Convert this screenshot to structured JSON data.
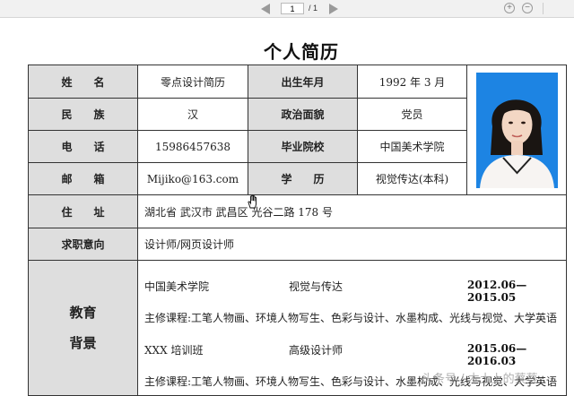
{
  "toolbar": {
    "page_current": "1",
    "page_total": "/ 1",
    "zoom_in": "+",
    "zoom_out": "−"
  },
  "resume": {
    "title": "个人简历",
    "rows": {
      "name_label": "姓　　名",
      "name_value": "零点设计简历",
      "birth_label": "出生年月",
      "birth_value": "1992 年 3 月",
      "ethnic_label": "民　　族",
      "ethnic_value": "汉",
      "political_label": "政治面貌",
      "political_value": "党员",
      "phone_label": "电　　话",
      "phone_value": "15986457638",
      "school_label": "毕业院校",
      "school_value": "中国美术学院",
      "email_label": "邮　　箱",
      "email_value": "Mijiko@163.com",
      "degree_label": "学　　历",
      "degree_value": "视觉传达(本科)",
      "address_label": "住　　址",
      "address_value": "湖北省  武汉市  武昌区  光谷二路  178 号",
      "intent_label": "求职意向",
      "intent_value": "设计师/网页设计师",
      "edu_label_1": "教育",
      "edu_label_2": "背景"
    },
    "education": [
      {
        "institution": "中国美术学院",
        "major": "视觉与传达",
        "dates": "2012.06—2015.05",
        "courses": "主修课程:工笔人物画、环境人物写生、色彩与设计、水墨构成、光线与视觉、大学英语"
      },
      {
        "institution": "XXX 培训班",
        "major": "高级设计师",
        "dates": "2015.06—2016.03",
        "courses": "主修课程:工笔人物画、环境人物写生、色彩与设计、水墨构成、光线与视觉、大学英语"
      }
    ]
  },
  "watermark": "头条号 / 木土上的蔡蔡",
  "colors": {
    "label_bg": "#dedede",
    "photo_bg": "#1d84e3",
    "toolbar_bg": "#f1f1f1"
  }
}
